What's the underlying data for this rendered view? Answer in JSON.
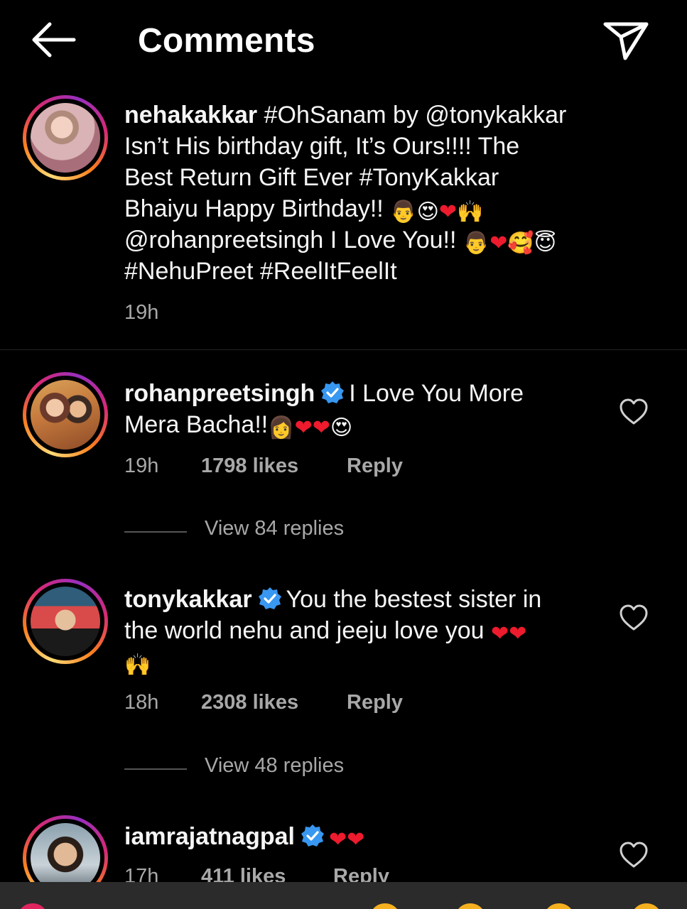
{
  "header": {
    "title": "Comments"
  },
  "caption": {
    "username": "nehakakkar",
    "line1": "#OhSanam by @tonykakkar",
    "line2": "Isn’t His birthday gift, It’s Ours!!!! The",
    "line3": "Best Return Gift Ever #TonyKakkar",
    "line4": "Bhaiyu Happy Birthday!!",
    "line5": "@rohanpreetsingh I Love You!!",
    "line6": "#NehuPreet #ReelItFeelIt",
    "time": "19h"
  },
  "comments": [
    {
      "username": "rohanpreetsingh",
      "line1": "I Love You More",
      "line2": "Mera Bacha!!",
      "time": "19h",
      "likes": "1798 likes",
      "reply": "Reply",
      "view_replies": "View 84 replies"
    },
    {
      "username": "tonykakkar",
      "line1": "You the bestest sister in",
      "line2": "the world nehu and jeeju love you",
      "time": "18h",
      "likes": "2308 likes",
      "reply": "Reply",
      "view_replies": "View 48 replies"
    },
    {
      "username": "iamrajatnagpal",
      "time": "17h",
      "likes": "411 likes",
      "reply": "Reply"
    }
  ],
  "icons": {
    "back": "back-arrow-icon",
    "share": "send-icon",
    "like": "heart-outline-icon",
    "verified": "verified-badge-icon"
  },
  "colors": {
    "background": "#000000",
    "text": "#f5f5f5",
    "secondary": "#a8a8a8",
    "verified": "#3897f0",
    "heart": "#ed1b2d"
  }
}
